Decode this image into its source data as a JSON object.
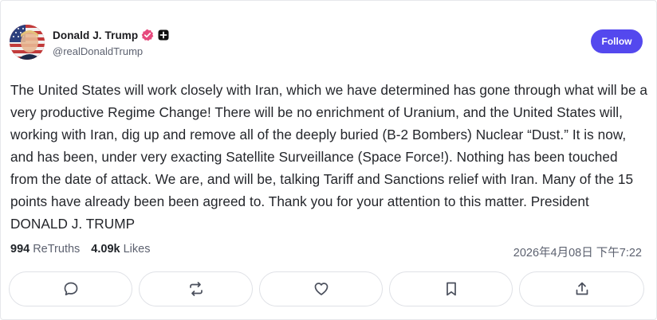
{
  "post": {
    "author": {
      "display_name": "Donald J. Trump",
      "handle": "@realDonaldTrump",
      "avatar_icon": "flag-portrait-avatar",
      "verified_icon": "verified-badge-icon",
      "plus_icon": "plus-badge-icon"
    },
    "follow_label": "Follow",
    "body": "The United States will work closely with Iran, which we have determined has gone through what will be a very productive Regime Change! There will be no enrichment of Uranium, and the United States will, working with Iran, dig up and remove all of the deeply buried (B-2 Bombers) Nuclear “Dust.” It is now, and has been, under very exacting Satellite Surveillance (Space Force!). Nothing has been touched from the date of attack. We are, and will be, talking Tariff and Sanctions relief with Iran. Many of the 15 points have already been been agreed to. Thank you for your attention to this matter. President DONALD J. TRUMP",
    "stats": {
      "retruths_count": "994",
      "retruths_label": "ReTruths",
      "likes_count": "4.09k",
      "likes_label": "Likes"
    },
    "timestamp": "2026年4月08日 下午7:22"
  },
  "actions": [
    {
      "name": "reply",
      "icon": "reply-bubble-icon"
    },
    {
      "name": "retruth",
      "icon": "retruth-arrows-icon"
    },
    {
      "name": "like",
      "icon": "heart-icon"
    },
    {
      "name": "bookmark",
      "icon": "bookmark-icon"
    },
    {
      "name": "share",
      "icon": "share-upload-icon"
    }
  ],
  "colors": {
    "accent": "#5448ee",
    "verified": "#e6497d",
    "text_muted": "#5d6270",
    "border": "#dfe1e6"
  }
}
